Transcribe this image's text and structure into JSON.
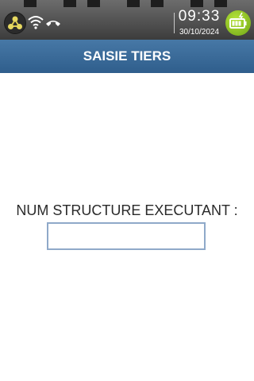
{
  "status_bar": {
    "time": "09:33",
    "date": "30/10/2024",
    "icons": [
      "network-icon",
      "wifi-icon",
      "phone-hangup-icon",
      "battery-charging-icon"
    ]
  },
  "header": {
    "title": "SAISIE TIERS"
  },
  "form": {
    "label": "NUM STRUCTURE EXECUTANT :",
    "input_value": "",
    "input_placeholder": ""
  },
  "colors": {
    "title_bar": "#3a6a98",
    "input_border": "#8fa9c9",
    "battery": "#8cc21f"
  }
}
